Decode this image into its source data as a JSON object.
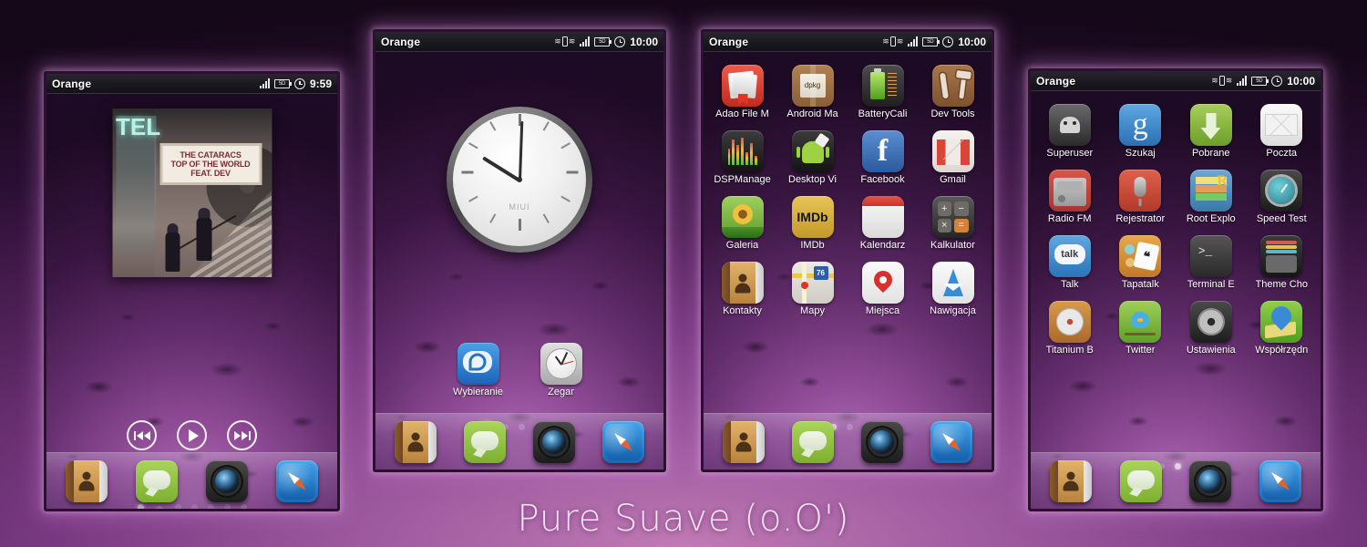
{
  "caption": "Pure Suave (o.O')",
  "theme": {
    "accent": "#a05ca0",
    "background_top": "#150818",
    "background_bottom": "#c07ab4",
    "frame_border": "#2b1030"
  },
  "panels": [
    {
      "id": "music-panel",
      "statusbar": {
        "carrier": "Orange",
        "time": "9:59",
        "battery_label": "5D",
        "icons": [
          "signal-icon",
          "battery-icon",
          "alarm-icon"
        ]
      },
      "widget": {
        "type": "music-player",
        "album": {
          "neon_text": "TEL",
          "marquee_line1": "THE CATARACS",
          "marquee_line2": "TOP OF THE WORLD",
          "marquee_line3": "FEAT. DEV"
        },
        "controls": [
          {
            "name": "previous-button",
            "label": "Previous"
          },
          {
            "name": "play-button",
            "label": "Play"
          },
          {
            "name": "next-button",
            "label": "Next"
          }
        ]
      },
      "pager": {
        "count": 7,
        "active": 0,
        "home_index": 1
      },
      "dock": [
        "Kontakty",
        "Wiadomości",
        "Aparat",
        "Przeglądarka"
      ]
    },
    {
      "id": "clock-panel",
      "statusbar": {
        "carrier": "Orange",
        "time": "10:00",
        "battery_label": "5D",
        "icons": [
          "vibrate-icon",
          "signal-icon",
          "battery-icon",
          "alarm-icon"
        ]
      },
      "widget": {
        "type": "analog-clock",
        "brand": "MIUI",
        "reads": "10:00"
      },
      "apps": [
        {
          "label": "Wybieranie",
          "icon": "wybieranie"
        },
        {
          "label": "Zegar",
          "icon": "zegar"
        }
      ],
      "pager": {
        "count": 7,
        "active": 1,
        "home_index": 1
      },
      "dock": [
        "Kontakty",
        "Wiadomości",
        "Aparat",
        "Przeglądarka"
      ]
    },
    {
      "id": "apps-panel-a",
      "statusbar": {
        "carrier": "Orange",
        "time": "10:00",
        "battery_label": "5D",
        "icons": [
          "vibrate-icon",
          "signal-icon",
          "battery-icon",
          "alarm-icon"
        ]
      },
      "rows": [
        [
          {
            "label": "Adao File M",
            "icon": "adao"
          },
          {
            "label": "Android Ma",
            "icon": "androidmarket"
          },
          {
            "label": "BatteryCali",
            "icon": "battery"
          },
          {
            "label": "Dev Tools",
            "icon": "devtools"
          }
        ],
        [
          {
            "label": "DSPManage",
            "icon": "dsp"
          },
          {
            "label": "Desktop Vi",
            "icon": "desktopvis"
          },
          {
            "label": "Facebook",
            "icon": "facebook"
          },
          {
            "label": "Gmail",
            "icon": "gmail"
          }
        ],
        [
          {
            "label": "Galeria",
            "icon": "galeria"
          },
          {
            "label": "IMDb",
            "icon": "imdb"
          },
          {
            "label": "Kalendarz",
            "icon": "kalendarz"
          },
          {
            "label": "Kalkulator",
            "icon": "kalkulator"
          }
        ],
        [
          {
            "label": "Kontakty",
            "icon": "kontakty"
          },
          {
            "label": "Mapy",
            "icon": "mapy"
          },
          {
            "label": "Miejsca",
            "icon": "miejsca"
          },
          {
            "label": "Nawigacja",
            "icon": "nawigacja"
          }
        ]
      ],
      "pager": {
        "count": 7,
        "active": 2,
        "home_index": 1
      },
      "dock": [
        "Kontakty",
        "Wiadomości",
        "Aparat",
        "Przeglądarka"
      ]
    },
    {
      "id": "apps-panel-b",
      "statusbar": {
        "carrier": "Orange",
        "time": "10:00",
        "battery_label": "5D",
        "icons": [
          "vibrate-icon",
          "signal-icon",
          "battery-icon",
          "alarm-icon"
        ]
      },
      "rows": [
        [
          {
            "label": "Superuser",
            "icon": "superuser"
          },
          {
            "label": "Szukaj",
            "icon": "szukaj"
          },
          {
            "label": "Pobrane",
            "icon": "pobrane"
          },
          {
            "label": "Poczta",
            "icon": "poczta"
          }
        ],
        [
          {
            "label": "Radio FM",
            "icon": "radiofm"
          },
          {
            "label": "Rejestrator",
            "icon": "rejestrator"
          },
          {
            "label": "Root Explo",
            "icon": "rootexplorer"
          },
          {
            "label": "Speed Test",
            "icon": "speedtest"
          }
        ],
        [
          {
            "label": "Talk",
            "icon": "talk"
          },
          {
            "label": "Tapatalk",
            "icon": "tapatalk"
          },
          {
            "label": "Terminal E",
            "icon": "terminal"
          },
          {
            "label": "Theme Cho",
            "icon": "themechooser"
          }
        ],
        [
          {
            "label": "Titanium B",
            "icon": "titanium"
          },
          {
            "label": "Twitter",
            "icon": "twitter"
          },
          {
            "label": "Ustawienia",
            "icon": "ustawienia"
          },
          {
            "label": "Współrzędn",
            "icon": "wspolrzedne"
          }
        ]
      ],
      "pager": {
        "count": 7,
        "active": 3,
        "home_index": 1
      },
      "dock": [
        "Kontakty",
        "Wiadomości",
        "Aparat",
        "Przeglądarka"
      ]
    }
  ],
  "icon_glyphs": {
    "imdb": "IMDb",
    "facebook": "f",
    "szukaj": "g",
    "talk": "talk",
    "tapatalk": "❝",
    "terminal": ">_",
    "mapy_shield": "76",
    "androidmarket": "dpkg",
    "kalkulator_keys": [
      "+",
      "−",
      "×",
      "="
    ]
  }
}
